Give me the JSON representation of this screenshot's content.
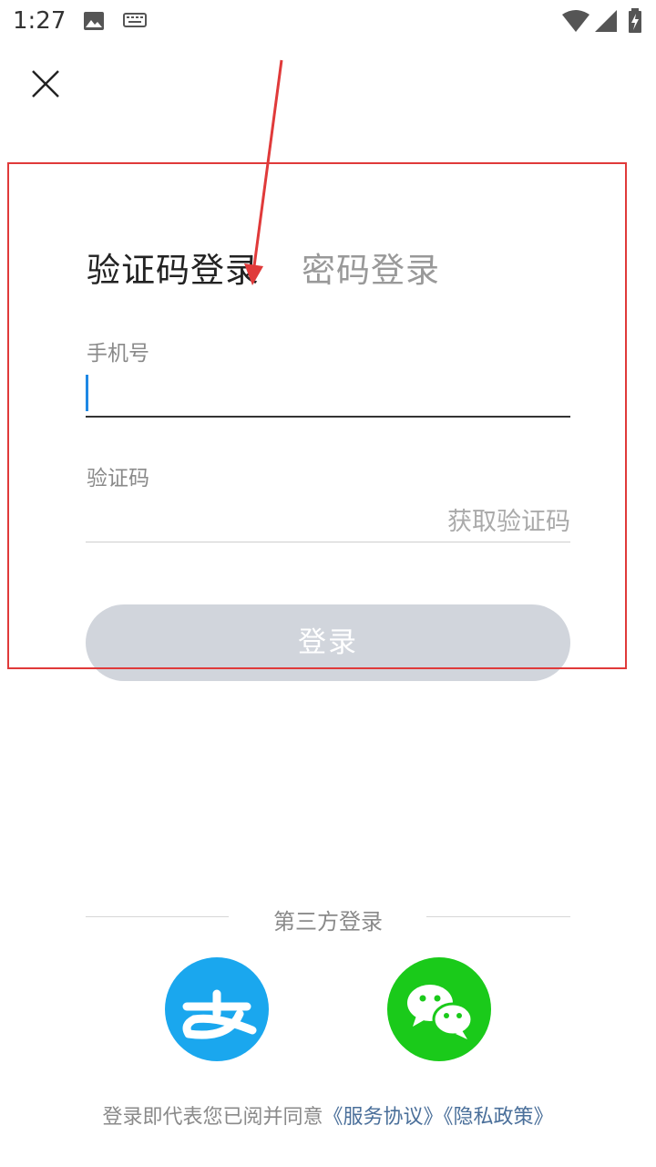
{
  "status_bar": {
    "time": "1:27"
  },
  "tabs": {
    "sms_login": "验证码登录",
    "password_login": "密码登录"
  },
  "form": {
    "phone_label": "手机号",
    "phone_value": "",
    "code_label": "验证码",
    "code_value": "",
    "get_code_label": "获取验证码",
    "login_button": "登录"
  },
  "third_party": {
    "title": "第三方登录",
    "providers": [
      "alipay-icon",
      "wechat-icon"
    ]
  },
  "agreement": {
    "prefix": "登录即代表您已阅并同意",
    "service_link": "《服务协议》",
    "privacy_link": "《隐私政策》"
  },
  "colors": {
    "accent": "#1e88e5",
    "alipay": "#1aa7ee",
    "wechat": "#1aca1a",
    "login_disabled": "#d1d5dc",
    "annotation": "#e03a3a"
  }
}
